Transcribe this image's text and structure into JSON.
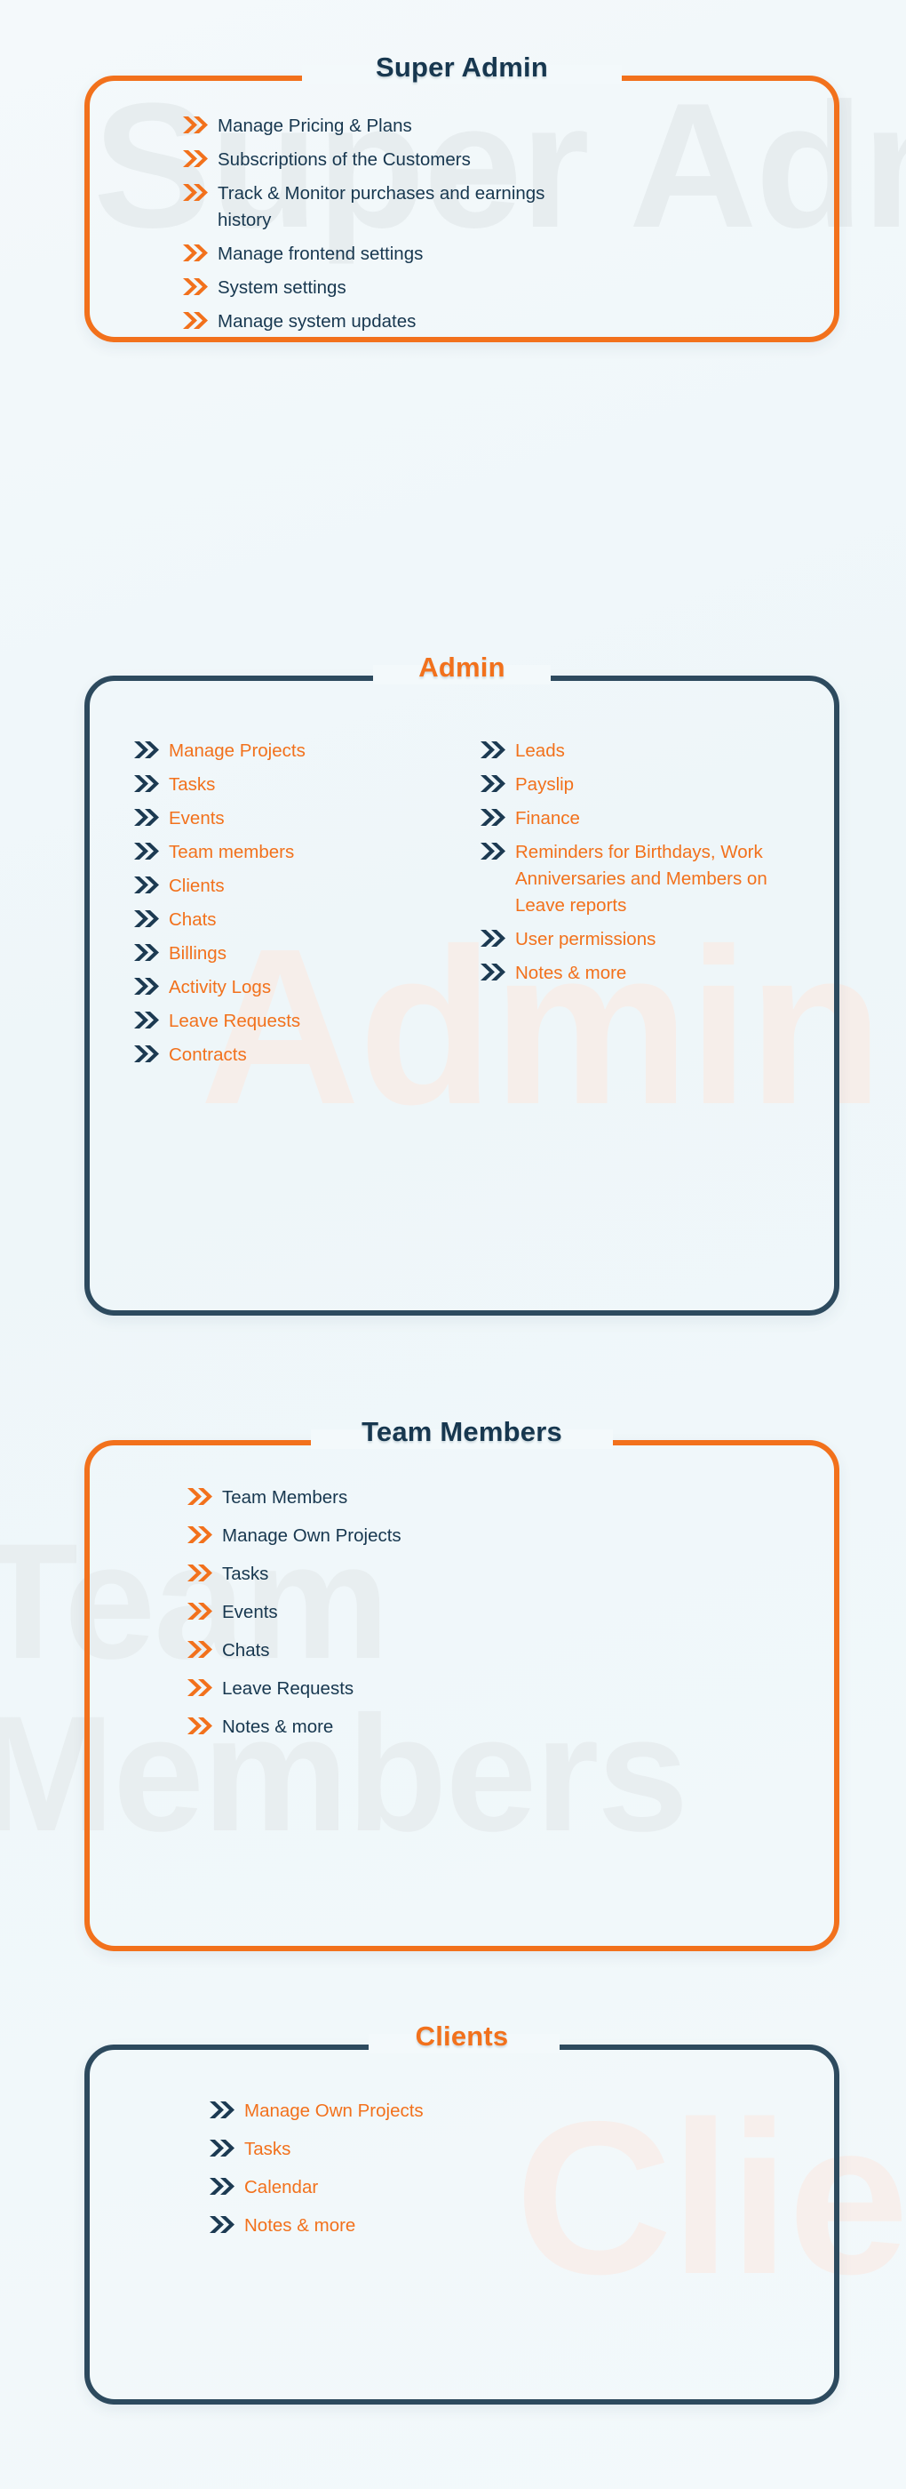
{
  "theme": {
    "orange": "#f2711c",
    "navy": "#17374f",
    "navy_border": "#2d4a5e",
    "background": "#f3f9fb"
  },
  "cards": [
    {
      "id": "super-admin",
      "title": "Super Admin",
      "watermark": "Super Admin",
      "items": [
        "Manage Pricing & Plans",
        "Subscriptions of the Customers",
        "Track & Monitor purchases and earnings history",
        "Manage frontend settings",
        "System settings",
        "Manage system updates"
      ]
    },
    {
      "id": "admin",
      "title": "Admin",
      "watermark": "Admin",
      "items_left": [
        "Manage Projects",
        "Tasks",
        "Events",
        "Team members",
        "Clients",
        "Chats",
        "Billings",
        "Activity Logs",
        "Leave Requests",
        "Contracts"
      ],
      "items_right": [
        "Leads",
        "Payslip",
        "Finance",
        "Reminders for Birthdays, Work Anniversaries and Members on Leave reports",
        "User permissions",
        "Notes & more"
      ]
    },
    {
      "id": "team-members",
      "title": "Team Members",
      "watermark": "Team Members",
      "items": [
        "Team Members",
        "Manage Own Projects",
        "Tasks",
        "Events",
        "Chats",
        "Leave Requests",
        "Notes & more"
      ]
    },
    {
      "id": "clients",
      "title": "Clients",
      "watermark": "Clients",
      "items": [
        "Manage Own Projects",
        "Tasks",
        "Calendar",
        "Notes & more"
      ]
    }
  ],
  "icons": {
    "chevron": "double-chevron-right-icon"
  }
}
